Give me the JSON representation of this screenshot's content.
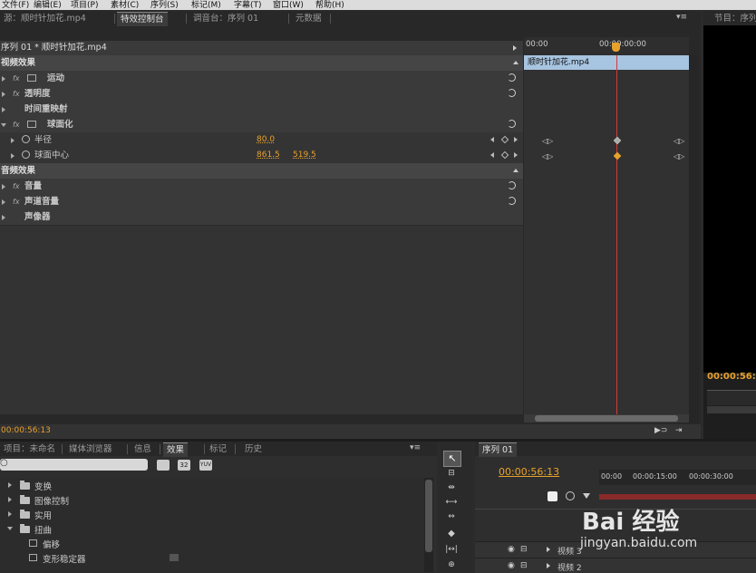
{
  "menu": [
    "文件(F)",
    "编辑(E)",
    "项目(P)",
    "素材(C)",
    "序列(S)",
    "标记(M)",
    "字幕(T)",
    "窗口(W)",
    "帮助(H)"
  ],
  "top_tabs": {
    "source": "源：顺时针加花.mp4",
    "effect_controls": "特效控制台",
    "mixer": "调音台：序列 01",
    "metadata": "元数据"
  },
  "program_tab": "节目：序列",
  "effect_controls": {
    "breadcrumb": "序列 01 * 顺时针加花.mp4",
    "timeline_start": "00:00",
    "timeline_mark": "00:00:00:00",
    "clip_name": "顺时针加花.mp4",
    "video_effects_label": "视频效果",
    "audio_effects_label": "音频效果",
    "video_effects": [
      "运动",
      "透明度",
      "时间重映射",
      "球面化"
    ],
    "params": [
      {
        "name": "半径",
        "value1": "80.0",
        "value2": ""
      },
      {
        "name": "球面中心",
        "value1": "861.5",
        "value2": "519.5"
      }
    ],
    "audio_effects": [
      "音量",
      "声道音量",
      "声像器"
    ],
    "current_time": "00:00:56:13"
  },
  "program_time": "00:00:56:",
  "project_panel": {
    "tabs": [
      "项目：未命名",
      "媒体浏览器",
      "信息",
      "效果",
      "标记",
      "历史"
    ],
    "tree": [
      {
        "label": "变换",
        "type": "folder"
      },
      {
        "label": "图像控制",
        "type": "folder"
      },
      {
        "label": "实用",
        "type": "folder"
      },
      {
        "label": "扭曲",
        "type": "folder",
        "open": true
      },
      {
        "label": "偏移",
        "type": "effect"
      },
      {
        "label": "变形稳定器",
        "type": "effect"
      }
    ]
  },
  "sequence_panel": {
    "tab": "序列 01",
    "time": "00:00:56:13",
    "ruler": [
      "00:00",
      "00:00:15:00",
      "00:00:30:00"
    ],
    "tracks": [
      "视频 3",
      "视频 2"
    ]
  },
  "watermark": {
    "brand": "Bai 经验",
    "url": "jingyan.baidu.com"
  }
}
